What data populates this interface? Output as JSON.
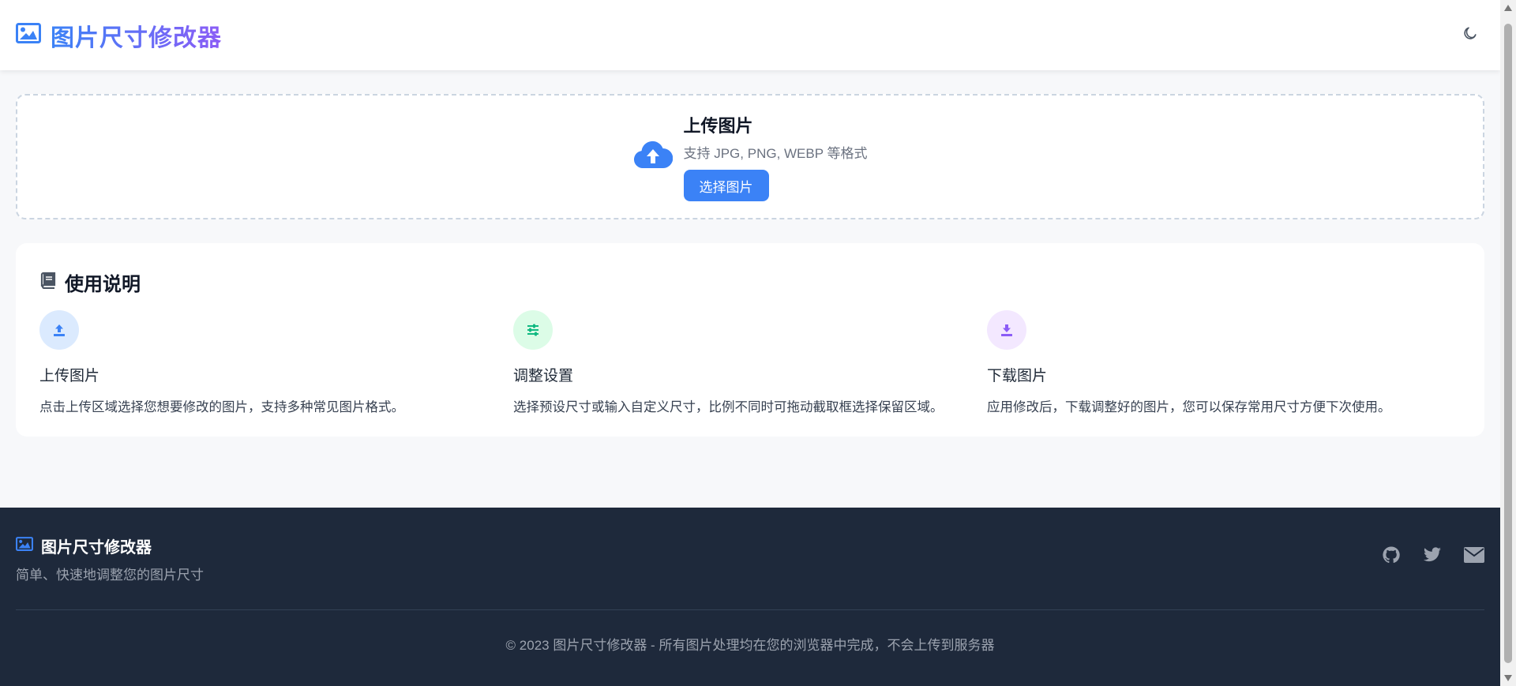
{
  "header": {
    "title": "图片尺寸修改器",
    "logo_icon": "image-icon",
    "theme_icon": "moon-icon"
  },
  "upload": {
    "icon": "cloud-upload-icon",
    "title": "上传图片",
    "subtitle": "支持 JPG, PNG, WEBP 等格式",
    "button_label": "选择图片"
  },
  "guide": {
    "icon": "book-icon",
    "title": "使用说明",
    "steps": [
      {
        "icon": "upload-icon",
        "title": "上传图片",
        "desc": "点击上传区域选择您想要修改的图片，支持多种常见图片格式。",
        "color": "#3b82f6",
        "bg": "#dbeafe"
      },
      {
        "icon": "sliders-icon",
        "title": "调整设置",
        "desc": "选择预设尺寸或输入自定义尺寸，比例不同时可拖动截取框选择保留区域。",
        "color": "#10b981",
        "bg": "#dcfce7"
      },
      {
        "icon": "download-icon",
        "title": "下载图片",
        "desc": "应用修改后，下载调整好的图片，您可以保存常用尺寸方便下次使用。",
        "color": "#8b5cf6",
        "bg": "#f3e8ff"
      }
    ]
  },
  "footer": {
    "title": "图片尺寸修改器",
    "tagline": "简单、快速地调整您的图片尺寸",
    "social": [
      "github-icon",
      "twitter-icon",
      "mail-icon"
    ],
    "copyright": "© 2023 图片尺寸修改器 - 所有图片处理均在您的浏览器中完成，不会上传到服务器"
  },
  "colors": {
    "accent": "#3b82f6",
    "accent_purple": "#8b5cf6",
    "footer_bg": "#1e293b"
  }
}
